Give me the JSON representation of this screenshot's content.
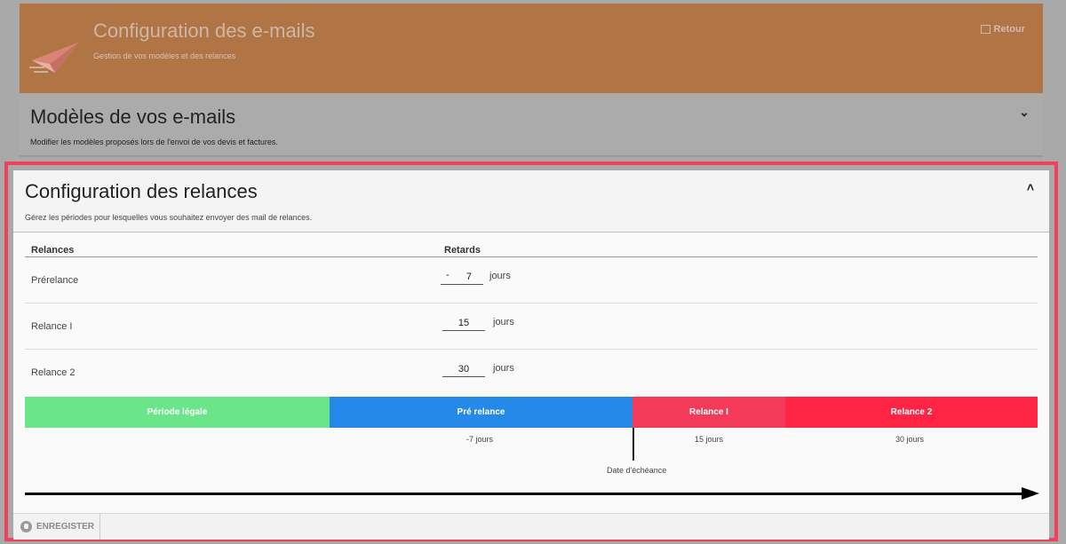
{
  "header": {
    "title": "Configuration des e-mails",
    "subtitle": "Gestion de vos modèles et des relances",
    "back_label": "Retour",
    "icon": "paper-plane-icon"
  },
  "models_panel": {
    "title": "Modèles de vos e-mails",
    "subtitle": "Modifier les modèles proposés lors de l'envoi de vos devis et factures.",
    "toggle_icon": "chevron-down-icon"
  },
  "relances_panel": {
    "title": "Configuration des relances",
    "subtitle": "Gérez les périodes pour lesquelles vous souhaitez envoyer des mail de relances.",
    "toggle_icon": "chevron-up-icon",
    "columns": [
      "Relances",
      "Retards"
    ],
    "rows": [
      {
        "label": "Prérelance",
        "prefix": "-",
        "value": "7",
        "unit": "jours"
      },
      {
        "label": "Relance I",
        "value": "15",
        "unit": "jours"
      },
      {
        "label": "Relance 2",
        "value": "30",
        "unit": "jours"
      }
    ],
    "timeline": {
      "segments": [
        {
          "label": "Période légale",
          "color": "#6ae589"
        },
        {
          "label": "Pré relance",
          "color": "#2489e8"
        },
        {
          "label": "Relance I",
          "color": "#f43a59"
        },
        {
          "label": "Relance 2",
          "color": "#ff2344"
        }
      ],
      "markers": [
        "-7 jours",
        "15 jours",
        "30 jours"
      ],
      "deadline_label": "Date d'échéance"
    },
    "save_label": "ENREGISTER"
  },
  "colors": {
    "accent": "#b07445",
    "highlight": "#f0405a"
  }
}
